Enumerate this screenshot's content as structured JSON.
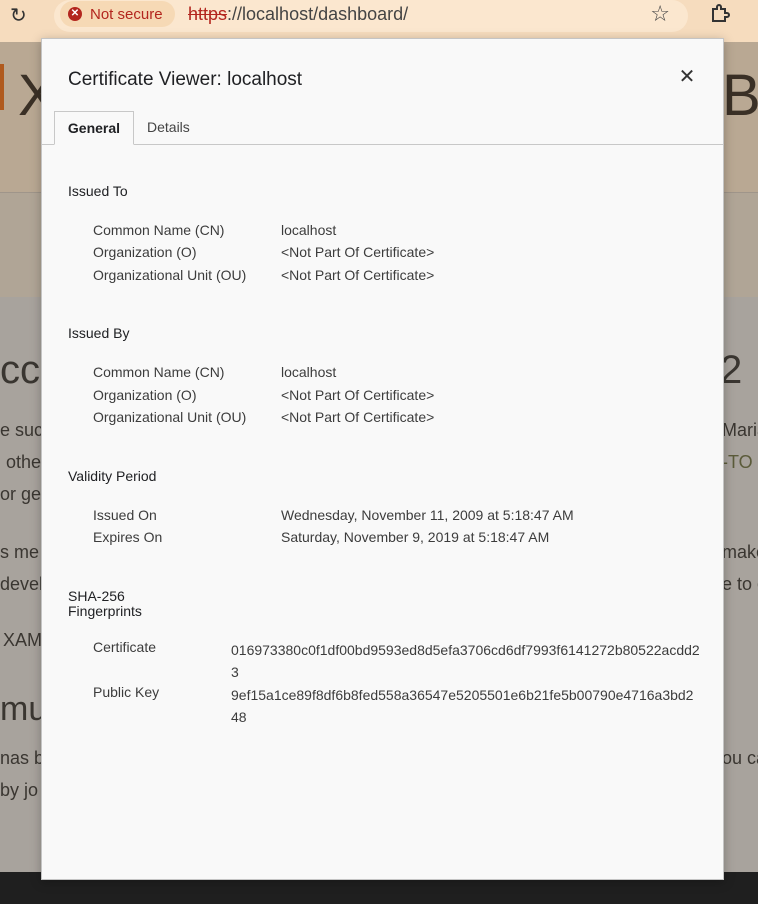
{
  "browser": {
    "security_label": "Not secure",
    "url_scheme": "https",
    "url_rest": "://localhost/dashboard/"
  },
  "background_page": {
    "logo_left": "X",
    "logo_right": "B",
    "fragments": [
      {
        "text": "cc"
      },
      {
        "text": "2"
      },
      {
        "text": "e suc"
      },
      {
        "text": "Maria"
      },
      {
        "text": "othe"
      },
      {
        "text": "-TO"
      },
      {
        "text": "or ge"
      },
      {
        "text": "s me"
      },
      {
        "text": "make"
      },
      {
        "text": "develo"
      },
      {
        "text": "e to c"
      },
      {
        "text": "XAM"
      },
      {
        "text": "mu"
      },
      {
        "text": "nas b"
      },
      {
        "text": "ou ca"
      },
      {
        "text": "by jo"
      }
    ]
  },
  "dialog": {
    "title": "Certificate Viewer: localhost",
    "tabs": [
      "General",
      "Details"
    ],
    "issued_to": {
      "heading": "Issued To",
      "rows": [
        {
          "label": "Common Name (CN)",
          "value": "localhost"
        },
        {
          "label": "Organization (O)",
          "value": "<Not Part Of Certificate>"
        },
        {
          "label": "Organizational Unit (OU)",
          "value": "<Not Part Of Certificate>"
        }
      ]
    },
    "issued_by": {
      "heading": "Issued By",
      "rows": [
        {
          "label": "Common Name (CN)",
          "value": "localhost"
        },
        {
          "label": "Organization (O)",
          "value": "<Not Part Of Certificate>"
        },
        {
          "label": "Organizational Unit (OU)",
          "value": "<Not Part Of Certificate>"
        }
      ]
    },
    "validity": {
      "heading": "Validity Period",
      "rows": [
        {
          "label": "Issued On",
          "value": "Wednesday, November 11, 2009 at 5:18:47 AM"
        },
        {
          "label": "Expires On",
          "value": "Saturday, November 9, 2019 at 5:18:47 AM"
        }
      ]
    },
    "fingerprints": {
      "heading_line1": "SHA-256",
      "heading_line2": "Fingerprints",
      "rows": [
        {
          "label": "Certificate",
          "value": "016973380c0f1df00bd9593ed8d5efa3706cd6df7993f6141272b80522acdd23"
        },
        {
          "label": "Public Key",
          "value": "9ef15a1ce89f8df6b8fed558a36547e5205501e6b21fe5b00790e4716a3bd248"
        }
      ]
    }
  }
}
